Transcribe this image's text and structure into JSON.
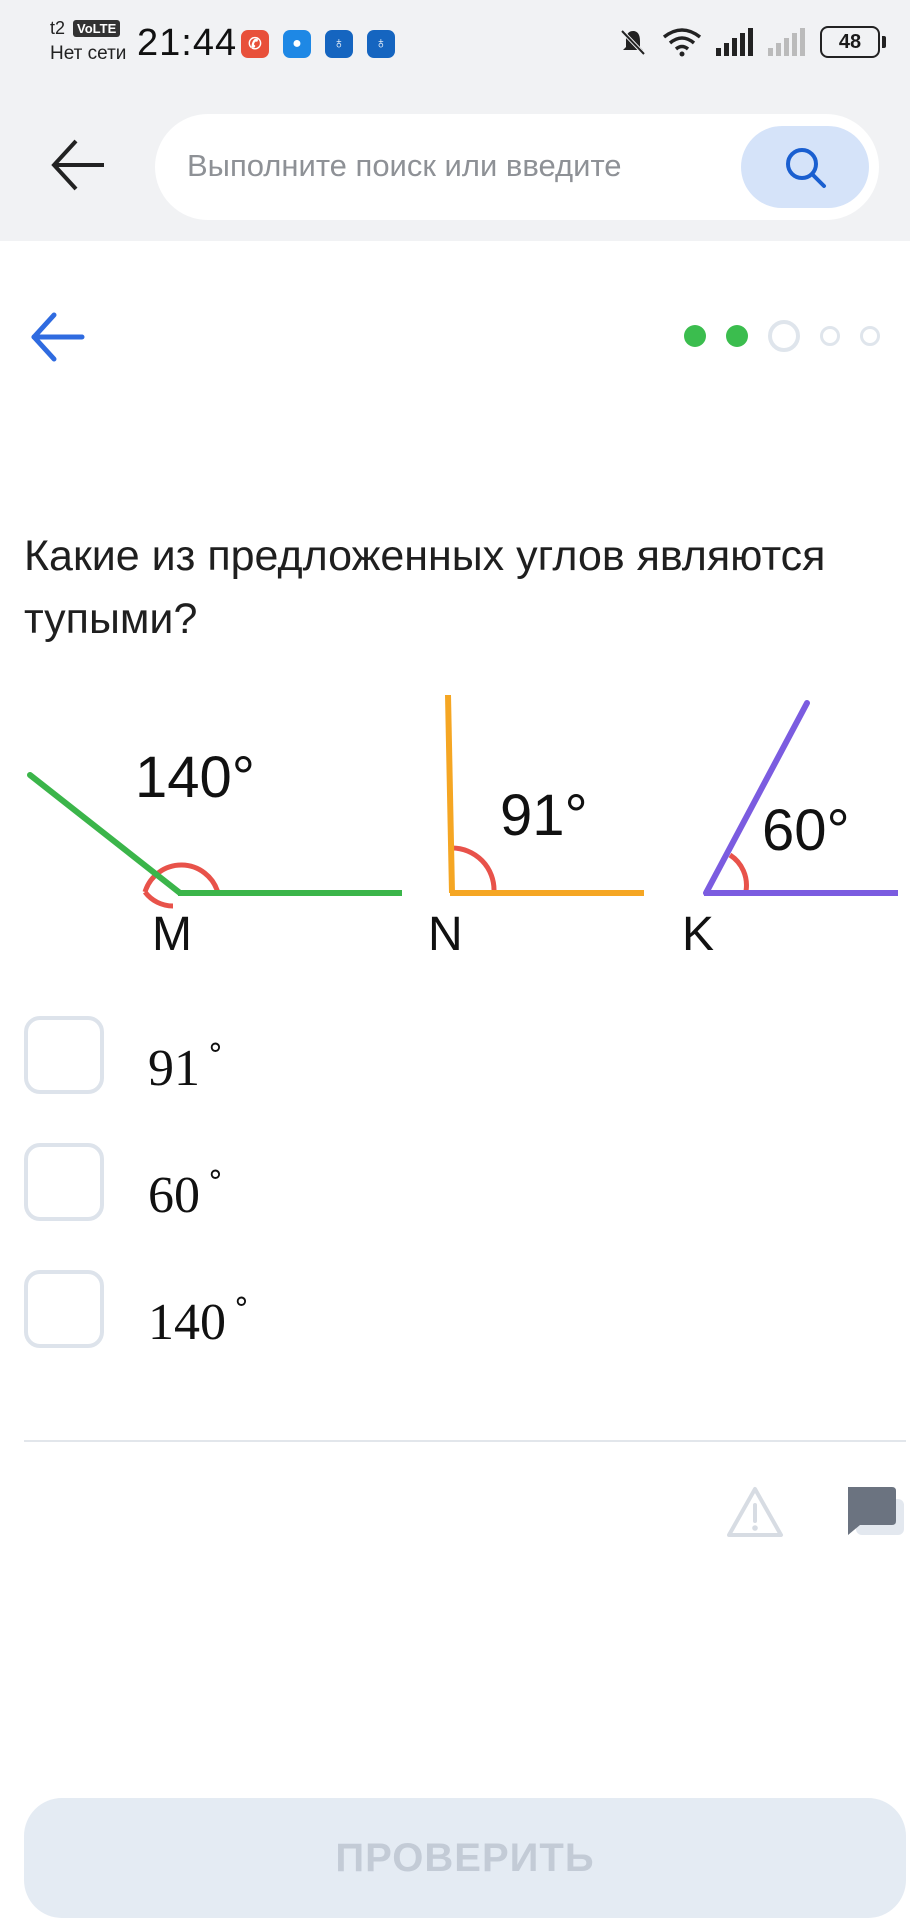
{
  "status_bar": {
    "carrier": "t2",
    "volte": "VoLTE",
    "network_text": "Нет сети",
    "time": "21:44",
    "battery": "48"
  },
  "browser": {
    "search_placeholder": "Выполните поиск или введите"
  },
  "progress": {
    "total": 5,
    "completed": 2,
    "current": 3
  },
  "question": {
    "text": "Какие из предложенных углов являются тупыми?"
  },
  "figure": {
    "angles": [
      {
        "vertex": "M",
        "label": "140°",
        "color": "#3bb54a"
      },
      {
        "vertex": "N",
        "label": "91°",
        "color": "#f5a623"
      },
      {
        "vertex": "K",
        "label": "60°",
        "color": "#7b5ce0"
      }
    ],
    "arc_color": "#e8524a"
  },
  "options": [
    {
      "value": "91",
      "checked": false
    },
    {
      "value": "60",
      "checked": false
    },
    {
      "value": "140",
      "checked": false
    }
  ],
  "check_button": {
    "label": "ПРОВЕРИТЬ",
    "enabled": false
  }
}
